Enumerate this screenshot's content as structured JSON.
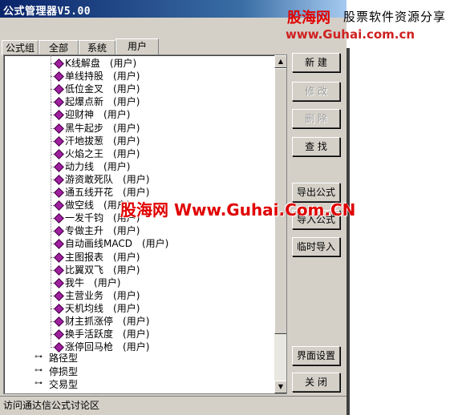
{
  "window": {
    "title": "公式管理器V5.00"
  },
  "tabs": [
    {
      "label": "公式组"
    },
    {
      "label": "全部"
    },
    {
      "label": "系统"
    },
    {
      "label": "用户"
    }
  ],
  "tree": {
    "formulas": [
      {
        "name": "K线解盘",
        "tag": "(用户)"
      },
      {
        "name": "单线持股",
        "tag": "(用户)"
      },
      {
        "name": "低位金叉",
        "tag": "(用户)"
      },
      {
        "name": "起爆点新",
        "tag": "(用户)"
      },
      {
        "name": "迎财神",
        "tag": "(用户)"
      },
      {
        "name": "黑牛起步",
        "tag": "(用户)"
      },
      {
        "name": "汗地拔葱",
        "tag": "(用户)"
      },
      {
        "name": "火焰之王",
        "tag": "(用户)"
      },
      {
        "name": "动力线",
        "tag": "(用户)"
      },
      {
        "name": "游资敢死队",
        "tag": "(用户)"
      },
      {
        "name": "通五线开花",
        "tag": "(用户)"
      },
      {
        "name": "做空线",
        "tag": "(用户)"
      },
      {
        "name": "一发千钧",
        "tag": "(用户)"
      },
      {
        "name": "专做主升",
        "tag": "(用户)"
      },
      {
        "name": "自动画线MACD",
        "tag": "(用户)"
      },
      {
        "name": "主图报表",
        "tag": "(用户)"
      },
      {
        "name": "比翼双飞",
        "tag": "(用户)"
      },
      {
        "name": "我牛",
        "tag": "(用户)"
      },
      {
        "name": "主营业务",
        "tag": "(用户)"
      },
      {
        "name": "天机均线",
        "tag": "(用户)"
      },
      {
        "name": "财主抓涨停",
        "tag": "(用户)"
      },
      {
        "name": "换手活跃度",
        "tag": "(用户)"
      },
      {
        "name": "涨停回马枪",
        "tag": "(用户)"
      }
    ],
    "groups": [
      {
        "name": "路径型"
      },
      {
        "name": "停损型"
      },
      {
        "name": "交易型"
      }
    ]
  },
  "buttons": {
    "new": "新 建",
    "edit": "修 改",
    "delete": "删 除",
    "find": "查 找",
    "export": "导出公式",
    "import": "导入公式",
    "temp_import": "临时导入",
    "ui_settings": "界面设置",
    "close": "关 闭"
  },
  "status": {
    "text": "访问通达信公式讨论区"
  },
  "logo": {
    "line1": "股海网",
    "line1b": "股票软件资源分享",
    "line2": "www.Guhai.com.cn"
  },
  "watermark": {
    "text": "股海网 Www.Guhai.Com.CN"
  },
  "colors": {
    "title_bar": "#0a246a",
    "diamond": "#a020a0",
    "watermark": "#e00000"
  }
}
